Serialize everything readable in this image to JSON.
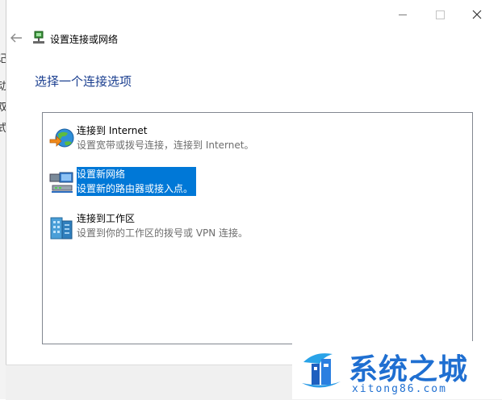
{
  "window": {
    "title": "设置连接或网络",
    "controls": [
      "minimize",
      "maximize",
      "close"
    ]
  },
  "heading": "选择一个连接选项",
  "options": [
    {
      "title": "连接到 Internet",
      "description": "设置宽带或拨号连接，连接到 Internet。",
      "icon": "globe-internet-icon",
      "selected": false
    },
    {
      "title": "设置新网络",
      "description": "设置新的路由器或接入点。",
      "icon": "network-router-icon",
      "selected": true
    },
    {
      "title": "连接到工作区",
      "description": "设置到你的工作区的拨号或 VPN 连接。",
      "icon": "workplace-building-icon",
      "selected": false
    }
  ],
  "background_window_fragments": [
    "记",
    "动",
    "双",
    "式"
  ],
  "watermark": {
    "name": "系统之城",
    "url": "xitong86.com"
  },
  "colors": {
    "heading": "#1a3e8f",
    "selection": "#0078d7",
    "watermark": "#1f6fd1"
  }
}
